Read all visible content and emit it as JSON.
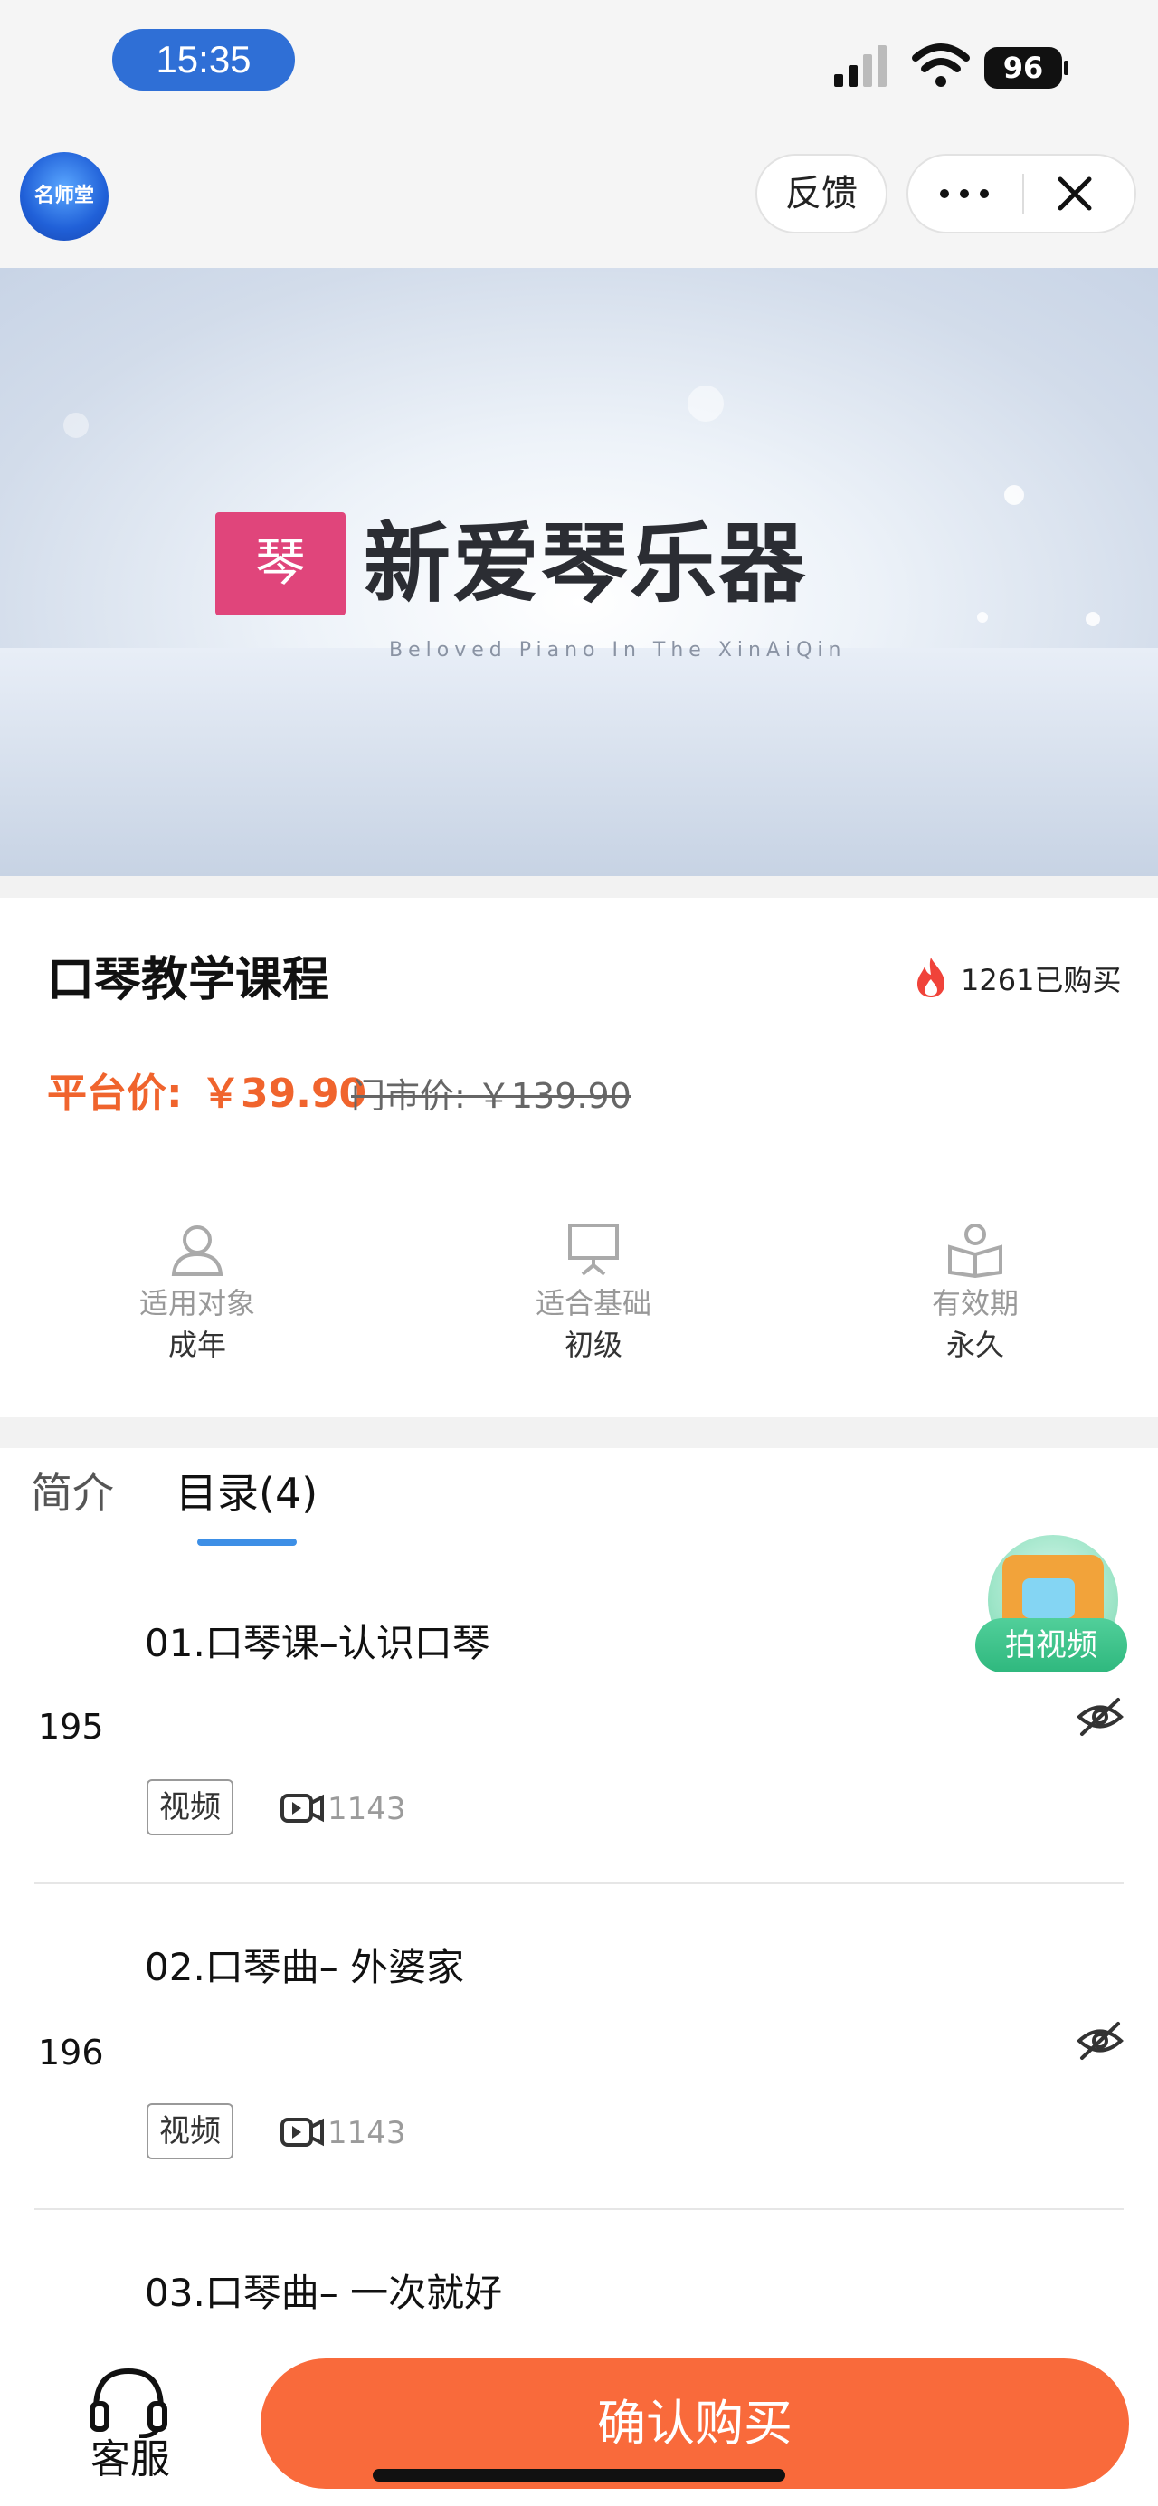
{
  "status_bar": {
    "time": "15:35",
    "battery": "96"
  },
  "top_bar": {
    "app_logo_text": "名师堂",
    "feedback_label": "反馈"
  },
  "banner": {
    "logo_text": "琴",
    "title": "新爱琴乐器",
    "subtitle": "Beloved Piano In The XinAiQin"
  },
  "course": {
    "title": "口琴教学课程",
    "purchased": "1261已购买",
    "price_label": "平台价:",
    "price_value": "￥39.90",
    "market_price": "门市价: ￥139.90"
  },
  "info": [
    {
      "icon": "person-icon",
      "label": "适用对象",
      "value": "成年"
    },
    {
      "icon": "easel-icon",
      "label": "适合基础",
      "value": "初级"
    },
    {
      "icon": "book-icon",
      "label": "有效期",
      "value": "永久"
    }
  ],
  "tabs": [
    {
      "label": "简介",
      "active": false
    },
    {
      "label": "目录(4)",
      "active": true
    }
  ],
  "float_button": {
    "label": "拍视频"
  },
  "lessons": [
    {
      "title": "01.口琴课–认识口琴",
      "number": "195",
      "tag": "视频",
      "count": "1143"
    },
    {
      "title": "02.口琴曲– 外婆家",
      "number": "196",
      "tag": "视频",
      "count": "1143"
    },
    {
      "title": "03.口琴曲– 一次就好"
    }
  ],
  "bottom_bar": {
    "service_label": "客服",
    "buy_label": "确认购买"
  },
  "colors": {
    "accent": "#f96a3b",
    "price": "#f0642d",
    "tab_underline": "#3d8fe6",
    "time_pill": "#2f6fd6"
  }
}
